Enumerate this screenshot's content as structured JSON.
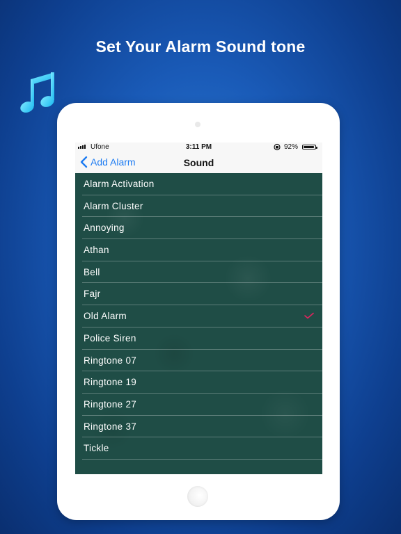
{
  "headline": "Set Your Alarm Sound tone",
  "status_bar": {
    "carrier": "Ufone",
    "time": "3:11 PM",
    "battery": "92%"
  },
  "nav": {
    "back_label": "Add Alarm",
    "title": "Sound"
  },
  "sounds": [
    {
      "label": "Alarm Activation",
      "selected": false
    },
    {
      "label": "Alarm Cluster",
      "selected": false
    },
    {
      "label": "Annoying",
      "selected": false
    },
    {
      "label": "Athan",
      "selected": false
    },
    {
      "label": "Bell",
      "selected": false
    },
    {
      "label": "Fajr",
      "selected": false
    },
    {
      "label": "Old Alarm",
      "selected": true
    },
    {
      "label": "Police Siren",
      "selected": false
    },
    {
      "label": "Ringtone 07",
      "selected": false
    },
    {
      "label": "Ringtone 19",
      "selected": false
    },
    {
      "label": "Ringtone 27",
      "selected": false
    },
    {
      "label": "Ringtone 37",
      "selected": false
    },
    {
      "label": "Tickle",
      "selected": false
    }
  ],
  "colors": {
    "accent": "#1e7cf2",
    "check": "#e0245e",
    "list_background": "#1f4d46"
  },
  "icons": {
    "decor": "music-note-icon",
    "back": "chevron-left-icon",
    "selected": "checkmark-icon"
  }
}
